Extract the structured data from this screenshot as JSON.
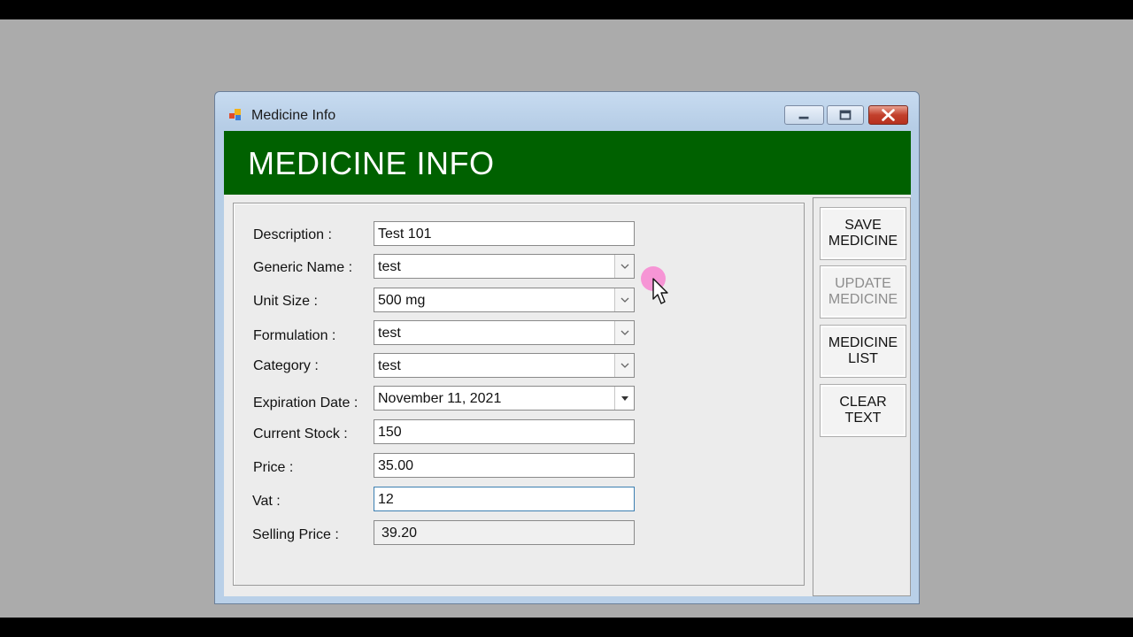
{
  "window": {
    "title": "Medicine Info"
  },
  "header": {
    "title": "MEDICINE INFO",
    "color": "#006100"
  },
  "form": {
    "description": {
      "label": "Description :",
      "value": "Test 101"
    },
    "generic_name": {
      "label": "Generic Name :",
      "value": "test"
    },
    "unit_size": {
      "label": "Unit Size :",
      "value": "500 mg"
    },
    "formulation": {
      "label": "Formulation :",
      "value": "test"
    },
    "category": {
      "label": "Category :",
      "value": "test"
    },
    "expiration_date": {
      "label": "Expiration Date :",
      "value": "November 11, 2021"
    },
    "current_stock": {
      "label": "Current Stock :",
      "value": "150"
    },
    "price": {
      "label": "Price :",
      "value": "35.00"
    },
    "vat": {
      "label": "Vat :",
      "value": "12"
    },
    "selling_price": {
      "label": "Selling Price :",
      "value": "39.20"
    }
  },
  "actions": {
    "save": "SAVE\nMEDICINE",
    "update": "UPDATE\nMEDICINE",
    "list": "MEDICINE\nLIST",
    "clear": "CLEAR\nTEXT"
  },
  "icons": {
    "app": "app-icon",
    "minimize": "minimize-icon",
    "maximize": "maximize-icon",
    "close": "close-icon",
    "dropdown": "chevron-down-icon",
    "cursor": "mouse-cursor-icon"
  }
}
